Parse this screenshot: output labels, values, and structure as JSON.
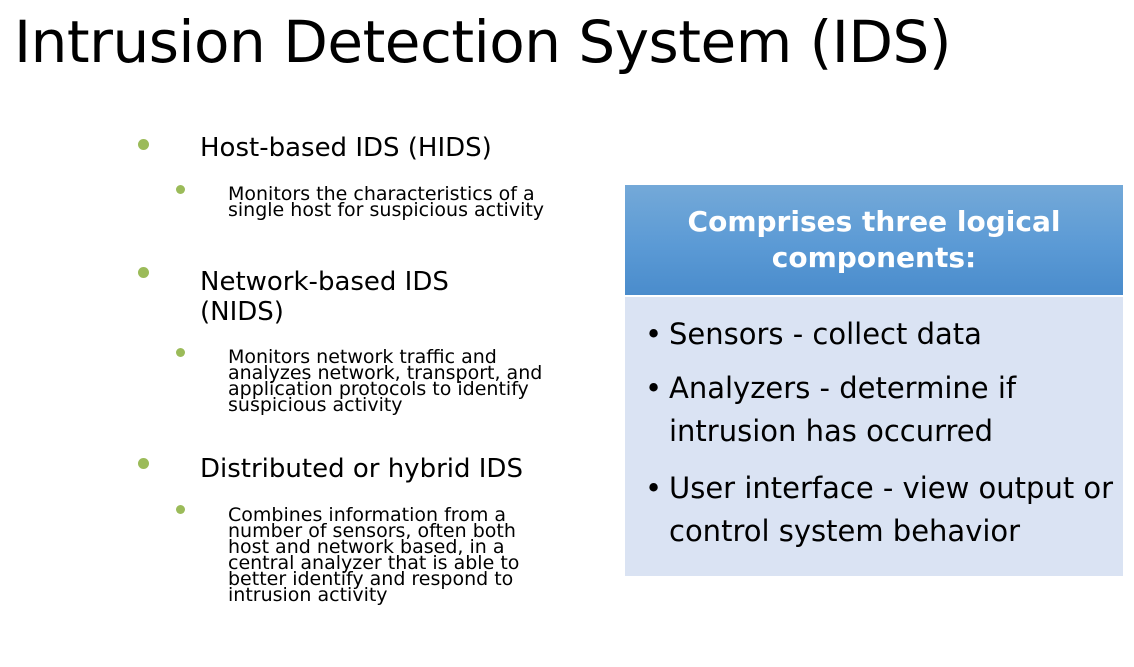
{
  "title": "Intrusion Detection System (IDS)",
  "colors": {
    "bullet": "#9bbb59",
    "header_bg": "#5b9ad5",
    "header_text": "#ffffff",
    "body_bg": "#dae3f3"
  },
  "left_list": [
    {
      "heading": "Host-based IDS (HIDS)",
      "detail": "Monitors the characteristics of a single host for suspicious activity"
    },
    {
      "heading": "Network-based IDS (NIDS)",
      "detail": "Monitors network traffic and analyzes network, transport, and application protocols to identify suspicious activity"
    },
    {
      "heading": "Distributed or hybrid IDS",
      "detail": "Combines information from a number of sensors, often both host and network based, in a central analyzer that is able to better identify and respond to intrusion activity"
    }
  ],
  "components_box": {
    "header": "Comprises three logical components:",
    "bullet_glyph": "•",
    "items": [
      "Sensors - collect data",
      "Analyzers - determine if intrusion has occurred",
      "User interface - view output or control system behavior"
    ]
  }
}
